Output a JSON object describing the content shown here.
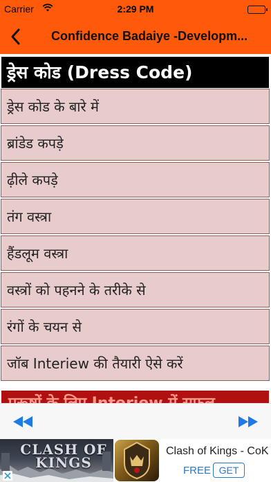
{
  "status_bar": {
    "carrier": "Carrier",
    "time": "2:29 PM",
    "battery_level": 1.0
  },
  "nav": {
    "back_icon": "chevron-left-icon",
    "title": "Confidence Badaiye -Developm..."
  },
  "heading": "ड्रेस कोड (Dress Code)",
  "list_items": [
    "ड्रेस कोड के बारे में",
    "ब्रांडेड कपड़े",
    "ढ़ीले कपड़े",
    "तंग वस्त्रा",
    "हैंडलूम वस्त्रा",
    "वस्त्रों को पहनने के तरीके से",
    "रंगों के चयन से",
    "जॉब Interiew की तैयारी ऐसे करें"
  ],
  "next_section_peek": "पुरूषों के लिए Interiew में सफल",
  "pager": {
    "prev_icon": "rewind-icon",
    "next_icon": "fast-forward-icon",
    "accent": "#1e7be6"
  },
  "ad": {
    "banner_title": "CLASH OF KINGS",
    "app_name": "Clash of Kings - CoK",
    "price": "FREE",
    "cta": "GET"
  },
  "colors": {
    "brand": "#ff5a0a",
    "row_bg": "#e8cccc",
    "heading_bg": "#000000"
  }
}
